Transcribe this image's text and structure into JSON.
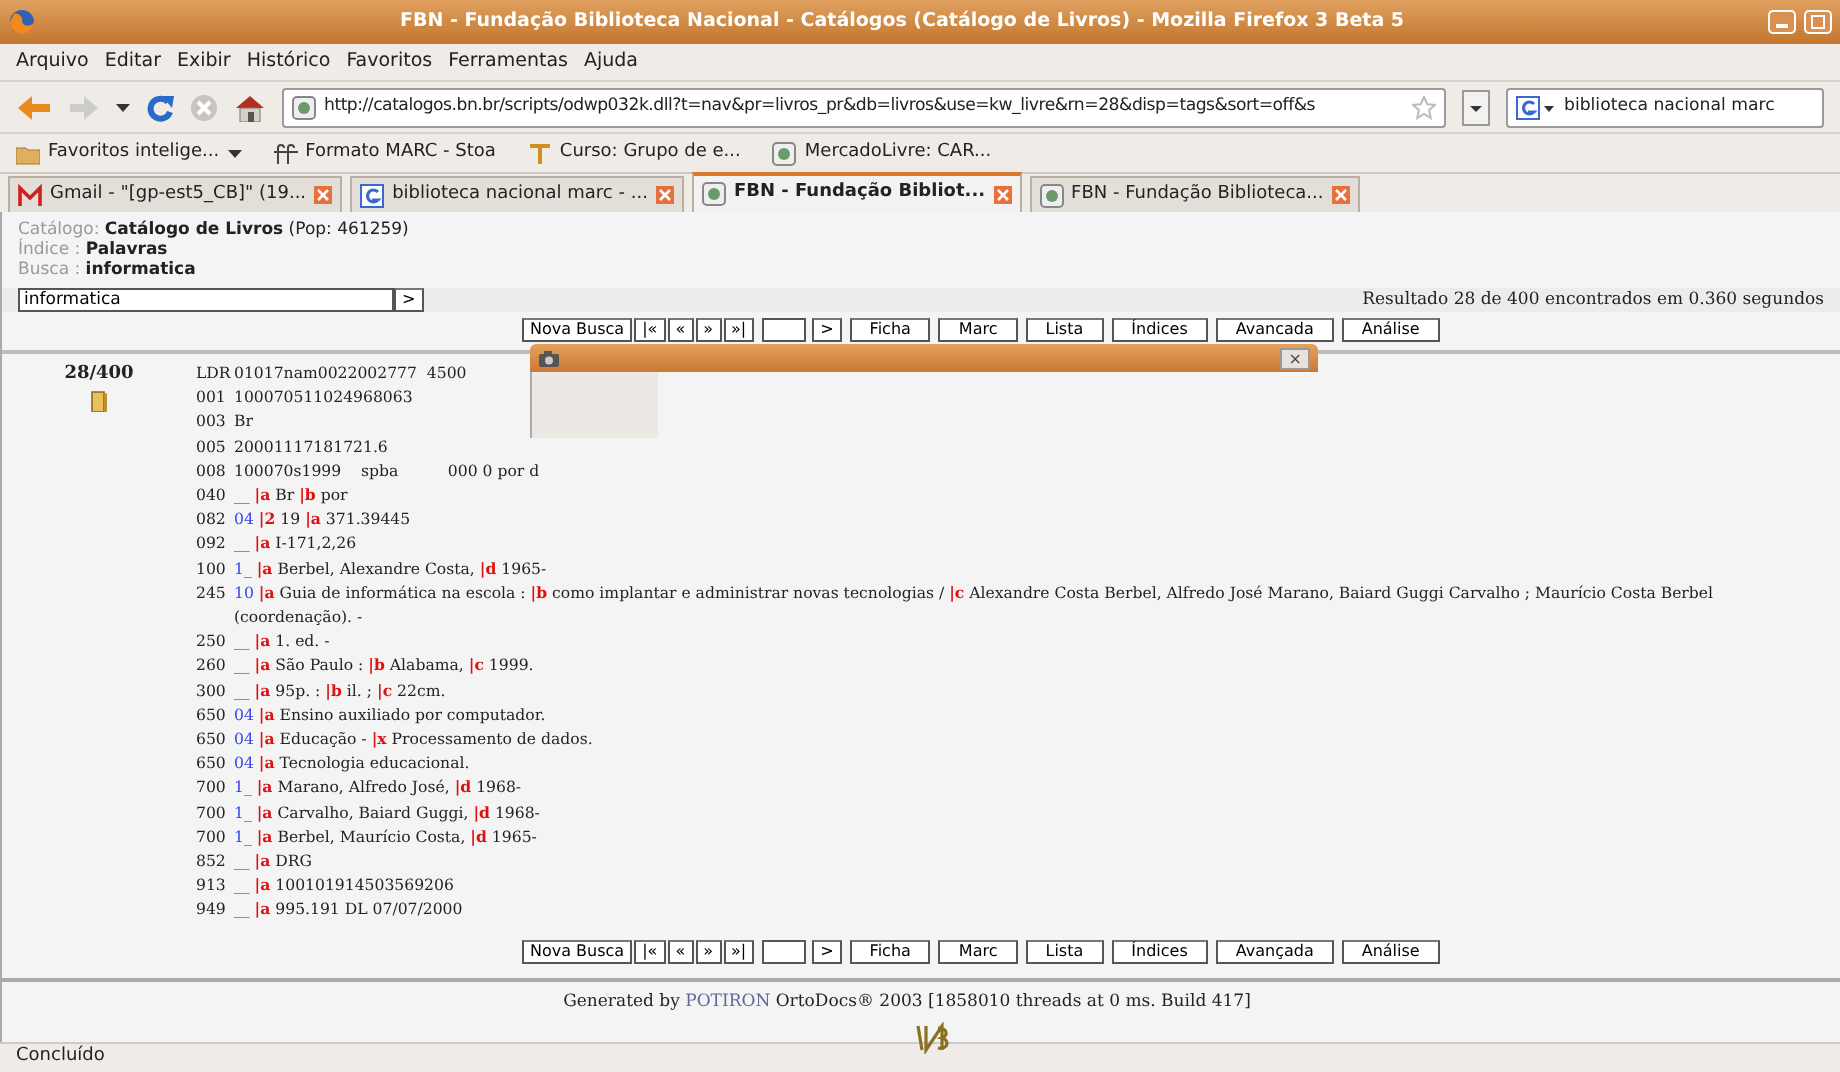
{
  "window": {
    "title": "FBN - Fundação Biblioteca Nacional - Catálogos (Catálogo de Livros) - Mozilla Firefox 3 Beta 5"
  },
  "menu": [
    "Arquivo",
    "Editar",
    "Exibir",
    "Histórico",
    "Favoritos",
    "Ferramentas",
    "Ajuda"
  ],
  "toolbar": {
    "url": "http://catalogos.bn.br/scripts/odwp032k.dll?t=nav&pr=livros_pr&db=livros&use=kw_livre&rn=28&disp=tags&sort=off&s",
    "search": "biblioteca nacional marc"
  },
  "bookmarks": [
    {
      "kind": "folder",
      "label": "Favoritos intelige..."
    },
    {
      "kind": "stoa",
      "label": "Formato MARC - Stoa"
    },
    {
      "kind": "course",
      "label": "Curso: Grupo de e..."
    },
    {
      "kind": "page",
      "label": "MercadoLivre: CAR..."
    }
  ],
  "tabs": [
    {
      "kind": "gmail",
      "label": "Gmail - \"[gp-est5_CB]\" (19...",
      "selected": false
    },
    {
      "kind": "google",
      "label": "biblioteca nacional marc - ...",
      "selected": false
    },
    {
      "kind": "page",
      "label": "FBN - Fundação Bibliot...",
      "selected": true
    },
    {
      "kind": "page",
      "label": "FBN - Fundação Biblioteca...",
      "selected": false
    }
  ],
  "catalog_info": [
    {
      "label": "Catálogo: ",
      "value": "Catálogo de Livros",
      "note": " (Pop: 461259)"
    },
    {
      "label": "Índice : ",
      "value": "Palavras"
    },
    {
      "label": "Busca : ",
      "value": "informatica"
    }
  ],
  "search": {
    "value": "informatica",
    "button": ">"
  },
  "result": "Resultado 28 de 400 encontrados em 0.360 segundos",
  "nav_top": [
    {
      "kind": "button",
      "label": "Nova Busca"
    },
    {
      "kind": "button",
      "label": "|«"
    },
    {
      "kind": "button",
      "label": "«"
    },
    {
      "kind": "button",
      "label": "»"
    },
    {
      "kind": "button",
      "label": "»|"
    },
    {
      "kind": "field"
    },
    {
      "kind": "button",
      "label": ">"
    },
    {
      "kind": "button",
      "label": "Ficha"
    },
    {
      "kind": "button",
      "label": "Marc"
    },
    {
      "kind": "button",
      "label": "Lista"
    },
    {
      "kind": "button",
      "label": "Índices"
    },
    {
      "kind": "button",
      "label": "Avancada"
    },
    {
      "kind": "button",
      "label": "Análise"
    }
  ],
  "popup": {
    "close": "×"
  },
  "record": {
    "position": "28/400",
    "fields": [
      {
        "kind": "control",
        "tag": "LDR",
        "value": "01017nam0022002777  4500"
      },
      {
        "kind": "control",
        "tag": "001",
        "value": "100070511024968063"
      },
      {
        "kind": "control",
        "tag": "003",
        "value": "Br"
      },
      {
        "kind": "control",
        "tag": "005",
        "value": "20001117181721.6"
      },
      {
        "kind": "control",
        "tag": "008",
        "value": "100070s1999    spba          000 0 por d"
      },
      {
        "kind": "data",
        "tag": "040",
        "ind": "__",
        "subfields": [
          {
            "code": "|a",
            "text": "Br"
          },
          {
            "code": "|b",
            "text": "por"
          }
        ]
      },
      {
        "kind": "data",
        "tag": "082",
        "ind": "04",
        "subfields": [
          {
            "code": "|2",
            "text": "19"
          },
          {
            "code": "|a",
            "text": "371.39445"
          }
        ]
      },
      {
        "kind": "data",
        "tag": "092",
        "ind": "__",
        "subfields": [
          {
            "code": "|a",
            "text": "I-171,2,26"
          }
        ]
      },
      {
        "kind": "data",
        "tag": "100",
        "ind": "1_",
        "subfields": [
          {
            "code": "|a",
            "text": "Berbel, Alexandre Costa,"
          },
          {
            "code": "|d",
            "text": "1965-"
          }
        ]
      },
      {
        "kind": "data",
        "tag": "245",
        "ind": "10",
        "subfields": [
          {
            "code": "|a",
            "text": "Guia de informática na escola :"
          },
          {
            "code": "|b",
            "text": "como implantar e administrar novas tecnologias /"
          },
          {
            "code": "|c",
            "text": "Alexandre Costa Berbel, Alfredo José Marano, Baiard Guggi Carvalho ; Maurício Costa Berbel (coordenação). -"
          }
        ]
      },
      {
        "kind": "data",
        "tag": "250",
        "ind": "__",
        "subfields": [
          {
            "code": "|a",
            "text": "1. ed. -"
          }
        ]
      },
      {
        "kind": "data",
        "tag": "260",
        "ind": "__",
        "subfields": [
          {
            "code": "|a",
            "text": "São Paulo :"
          },
          {
            "code": "|b",
            "text": "Alabama,"
          },
          {
            "code": "|c",
            "text": "1999."
          }
        ]
      },
      {
        "kind": "data",
        "tag": "300",
        "ind": "__",
        "subfields": [
          {
            "code": "|a",
            "text": "95p. :"
          },
          {
            "code": "|b",
            "text": "il. ;"
          },
          {
            "code": "|c",
            "text": "22cm."
          }
        ]
      },
      {
        "kind": "data",
        "tag": "650",
        "ind": "04",
        "subfields": [
          {
            "code": "|a",
            "text": "Ensino auxiliado por computador."
          }
        ]
      },
      {
        "kind": "data",
        "tag": "650",
        "ind": "04",
        "subfields": [
          {
            "code": "|a",
            "text": "Educação -"
          },
          {
            "code": "|x",
            "text": "Processamento de dados."
          }
        ]
      },
      {
        "kind": "data",
        "tag": "650",
        "ind": "04",
        "subfields": [
          {
            "code": "|a",
            "text": "Tecnologia educacional."
          }
        ]
      },
      {
        "kind": "data",
        "tag": "700",
        "ind": "1_",
        "subfields": [
          {
            "code": "|a",
            "text": "Marano, Alfredo José,"
          },
          {
            "code": "|d",
            "text": "1968-"
          }
        ]
      },
      {
        "kind": "data",
        "tag": "700",
        "ind": "1_",
        "subfields": [
          {
            "code": "|a",
            "text": "Carvalho, Baiard Guggi,"
          },
          {
            "code": "|d",
            "text": "1968-"
          }
        ]
      },
      {
        "kind": "data",
        "tag": "700",
        "ind": "1_",
        "subfields": [
          {
            "code": "|a",
            "text": "Berbel, Maurício Costa,"
          },
          {
            "code": "|d",
            "text": "1965-"
          }
        ]
      },
      {
        "kind": "data",
        "tag": "852",
        "ind": "__",
        "subfields": [
          {
            "code": "|a",
            "text": "DRG"
          }
        ]
      },
      {
        "kind": "data",
        "tag": "913",
        "ind": "__",
        "subfields": [
          {
            "code": "|a",
            "text": "100101914503569206"
          }
        ]
      },
      {
        "kind": "data",
        "tag": "949",
        "ind": "__",
        "subfields": [
          {
            "code": "|a",
            "text": "995.191 DL 07/07/2000"
          }
        ]
      }
    ]
  },
  "nav_bottom": [
    {
      "kind": "button",
      "label": "Nova Busca"
    },
    {
      "kind": "button",
      "label": "|«"
    },
    {
      "kind": "button",
      "label": "«"
    },
    {
      "kind": "button",
      "label": "»"
    },
    {
      "kind": "button",
      "label": "»|"
    },
    {
      "kind": "field"
    },
    {
      "kind": "button",
      "label": ">"
    },
    {
      "kind": "button",
      "label": "Ficha"
    },
    {
      "kind": "button",
      "label": "Marc"
    },
    {
      "kind": "button",
      "label": "Lista"
    },
    {
      "kind": "button",
      "label": "Índices"
    },
    {
      "kind": "button",
      "label": "Avançada"
    },
    {
      "kind": "button",
      "label": "Análise"
    }
  ],
  "footer": {
    "prefix": "Generated by ",
    "brand": "POTIRON",
    "suffix": " OrtoDocs® 2003 [1858010 threads at 0 ms. Build 417]"
  },
  "status_bar": "Concluído"
}
